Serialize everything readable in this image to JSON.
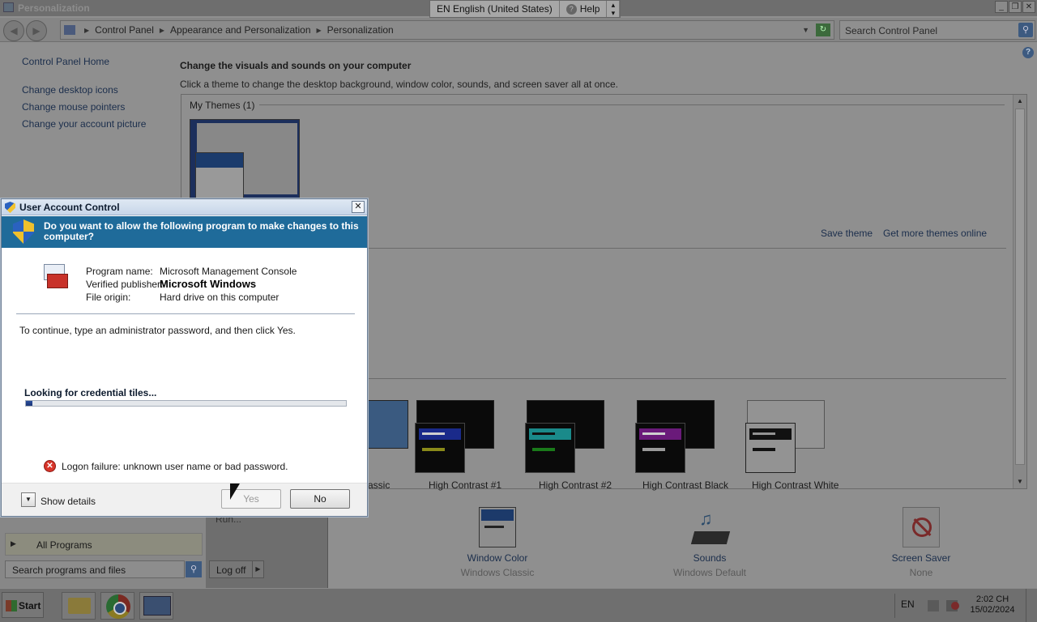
{
  "window": {
    "title": "Personalization",
    "controls": [
      "_",
      "❐",
      "✕"
    ]
  },
  "language_bar": {
    "language": "EN English (United States)",
    "help": "Help",
    "help_icon": "help-icon"
  },
  "address_bar": {
    "back_icon": "back-arrow-icon",
    "forward_icon": "forward-arrow-icon",
    "crumbs": [
      "Control Panel",
      "Appearance and Personalization",
      "Personalization"
    ],
    "search_placeholder": "Search Control Panel"
  },
  "left_pane": {
    "home": "Control Panel Home",
    "links": [
      "Change desktop icons",
      "Change mouse pointers",
      "Change your account picture"
    ]
  },
  "content": {
    "heading": "Change the visuals and sounds on your computer",
    "subheading": "Click a theme to change the desktop background, window color, sounds, and screen saver all at once.",
    "my_themes_label": "My Themes (1)",
    "save_theme": "Save theme",
    "get_more": "Get more themes online",
    "themes": [
      {
        "label": "Windows Classic",
        "visible_label": "assic"
      },
      {
        "label": "High Contrast #1",
        "accent": "#1a2a8a",
        "line": "#8a8a1a"
      },
      {
        "label": "High Contrast #2",
        "accent": "#1a8a8a",
        "line": "#1a7a1a"
      },
      {
        "label": "High Contrast Black",
        "accent": "#6a1a7a",
        "line": "#9a9a9a"
      },
      {
        "label": "High Contrast White",
        "accent": "#111111",
        "line": "#111111"
      }
    ]
  },
  "bottom_settings": [
    {
      "label": "Window Color",
      "value": "Windows Classic",
      "icon": "window-color-icon"
    },
    {
      "label": "Sounds",
      "value": "Windows Default",
      "icon": "sounds-icon"
    },
    {
      "label": "Screen Saver",
      "value": "None",
      "icon": "screen-saver-icon"
    }
  ],
  "start_menu": {
    "run": "Run...",
    "all_programs": "All Programs",
    "search_placeholder": "Search programs and files",
    "log_off": "Log off"
  },
  "taskbar": {
    "start": "Start",
    "apps": [
      "file-explorer-icon",
      "chrome-icon",
      "mmc-icon"
    ],
    "lang": "EN",
    "time": "2:02 CH",
    "date": "15/02/2024"
  },
  "uac": {
    "title": "User Account Control",
    "question": "Do you want to allow the following program to make changes to this computer?",
    "program_name_label": "Program name:",
    "program_name": "Microsoft Management Console",
    "publisher_label": "Verified publisher:",
    "publisher": "Microsoft Windows",
    "origin_label": "File origin:",
    "origin": "Hard drive on this computer",
    "instruction": "To continue, type an administrator password, and then click Yes.",
    "looking": "Looking for credential tiles...",
    "progress": 0.02,
    "error": "Logon failure: unknown user name or bad password.",
    "show_details": "Show details",
    "yes": "Yes",
    "no": "No"
  }
}
